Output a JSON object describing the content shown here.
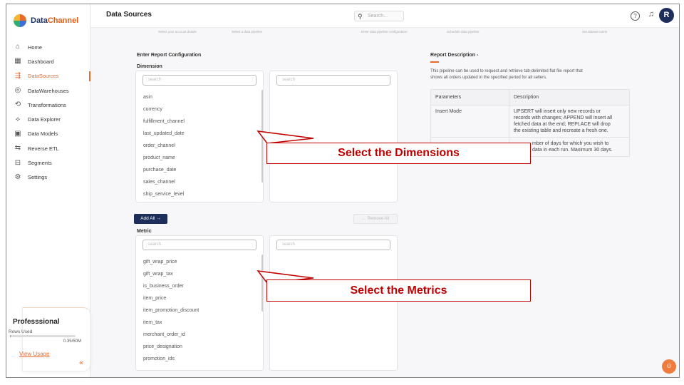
{
  "app": {
    "brand_part1": "Data",
    "brand_part2": "Channel",
    "brand_accent": "#e96b2b",
    "navy": "#1d2e5a"
  },
  "sidebar": {
    "items": [
      {
        "label": "Home",
        "icon": "home-icon",
        "glyph": "⌂"
      },
      {
        "label": "Dashboard",
        "icon": "dashboard-icon",
        "glyph": "▦"
      },
      {
        "label": "DataSources",
        "icon": "datasources-icon",
        "glyph": "⇶",
        "active": true
      },
      {
        "label": "DataWarehouses",
        "icon": "database-icon",
        "glyph": "◎"
      },
      {
        "label": "Transformations",
        "icon": "transform-icon",
        "glyph": "⟲"
      },
      {
        "label": "Data Explorer",
        "icon": "explorer-icon",
        "glyph": "⟡"
      },
      {
        "label": "Data Models",
        "icon": "models-icon",
        "glyph": "▣"
      },
      {
        "label": "Reverse ETL",
        "icon": "reverse-etl-icon",
        "glyph": "⇆"
      },
      {
        "label": "Segments",
        "icon": "segments-icon",
        "glyph": "⊟"
      },
      {
        "label": "Settings",
        "icon": "gear-icon",
        "glyph": "⚙"
      }
    ],
    "plan": {
      "title": "Professsional",
      "rows_label": "Rows Used",
      "count": "0.35/50M",
      "usage_fraction": 0.007,
      "link": "View Usage"
    },
    "collapse_glyph": "«"
  },
  "header": {
    "title": "Data Sources",
    "search_placeholder": "Search...",
    "avatar_initial": "R"
  },
  "steps": [
    "Select your account details",
    "Select a data pipeline",
    "Enter data pipeline configuration",
    "Schedule data pipeline",
    "Set dataset name"
  ],
  "config": {
    "heading": "Enter Report Configuration",
    "dimension_label": "Dimension",
    "metric_label": "Metric",
    "search_placeholder": "search",
    "dimensions": [
      "asin",
      "currency",
      "fulfillment_channel",
      "last_updated_date",
      "order_channel",
      "product_name",
      "purchase_date",
      "sales_channel",
      "ship_service_level"
    ],
    "metrics": [
      "gift_wrap_price",
      "gift_wrap_tax",
      "is_business_order",
      "item_price",
      "item_promotion_discount",
      "item_tax",
      "merchant_order_id",
      "price_designation",
      "promotion_ids"
    ],
    "add_all": "Add All →",
    "remove_all": "← Remove All"
  },
  "report": {
    "title": "Report Description -",
    "description_line1": "This pipeline can be used to request and retrieve tab-delimited flat file report that",
    "description_line2": "shows all orders updated in the specified period for all sellers.",
    "table_headers": [
      "Parameters",
      "Description"
    ],
    "rows": [
      {
        "param": "Insert Mode",
        "desc_lines": [
          "UPSERT will insert only new records or",
          "records with changes; APPEND will insert all",
          "fetched data at the end; REPLACE will drop",
          "the existing table and recreate a fresh one."
        ]
      },
      {
        "param": "",
        "desc_lines": [
          "mber of days for which you wish to",
          "data in each run. Maximum 30 days."
        ]
      }
    ]
  },
  "callouts": {
    "dimensions": "Select the Dimensions",
    "metrics": "Select the Metrics"
  }
}
